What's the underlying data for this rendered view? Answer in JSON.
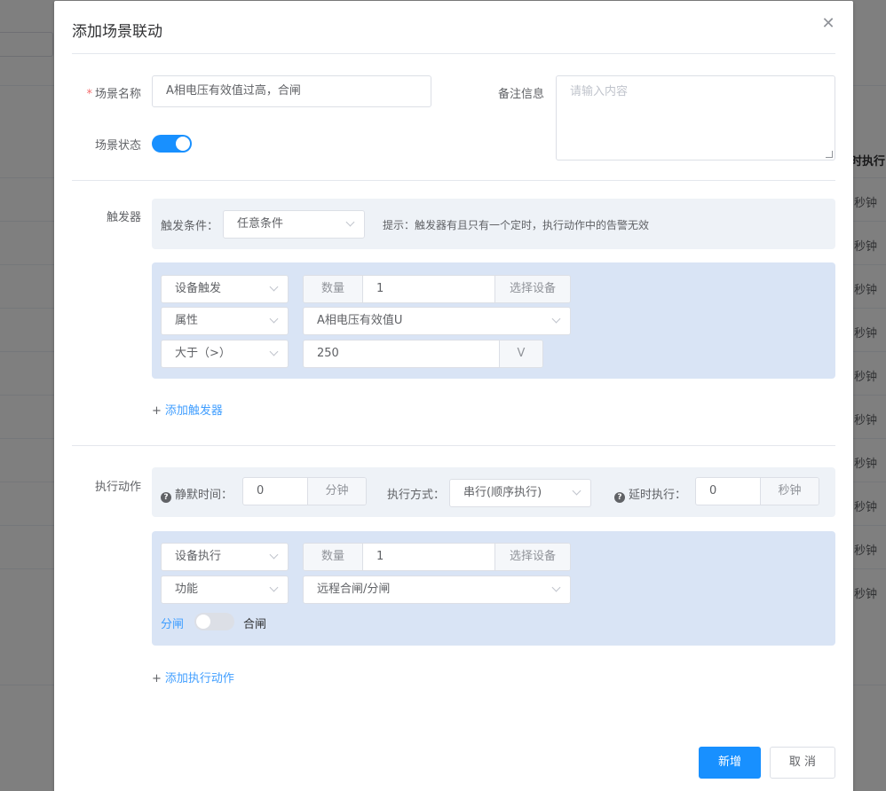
{
  "background": {
    "column_header": "时执行",
    "cells": [
      "秒钟",
      "秒钟",
      "秒钟",
      "秒钟",
      "秒钟",
      "秒钟",
      "秒钟",
      "秒钟",
      "秒钟",
      "秒钟"
    ]
  },
  "dialog": {
    "title": "添加场景联动",
    "close_icon": "close-icon"
  },
  "form": {
    "scene_name": {
      "required_mark": "*",
      "label": "场景名称",
      "value": "A相电压有效值过高，合闸"
    },
    "remark": {
      "label": "备注信息",
      "placeholder": "请输入内容"
    },
    "scene_status": {
      "label": "场景状态",
      "enabled": true
    }
  },
  "trigger": {
    "label": "触发器",
    "condition_label": "触发条件：",
    "condition_value": "任意条件",
    "hint": "提示：触发器有且只有一个定时，执行动作中的告警无效",
    "item": {
      "type": "设备触发",
      "count_label": "数量",
      "count_value": "1",
      "select_device": "选择设备",
      "property_type": "属性",
      "property_value": "A相电压有效值U",
      "operator": "大于（>）",
      "threshold": "250",
      "unit": "V"
    },
    "add_link": {
      "plus": "+",
      "label": "添加触发器"
    }
  },
  "action": {
    "label": "执行动作",
    "silence_label": "静默时间：",
    "silence_value": "0",
    "silence_unit": "分钟",
    "mode_label": "执行方式：",
    "mode_value": "串行(顺序执行)",
    "delay_label": "延时执行：",
    "delay_value": "0",
    "delay_unit": "秒钟",
    "item": {
      "type": "设备执行",
      "count_label": "数量",
      "count_value": "1",
      "select_device": "选择设备",
      "function_type": "功能",
      "function_value": "远程合闸/分闸",
      "off_label": "分闸",
      "on_label": "合闸",
      "switch_on": false
    },
    "add_link": {
      "plus": "+",
      "label": "添加执行动作"
    }
  },
  "footer": {
    "submit": "新增",
    "cancel": "取 消"
  },
  "colors": {
    "primary": "#1890ff",
    "link": "#409eff",
    "panel_gray": "#eef2f7",
    "panel_blue": "#d9e4f5",
    "required": "#f56c6c"
  }
}
